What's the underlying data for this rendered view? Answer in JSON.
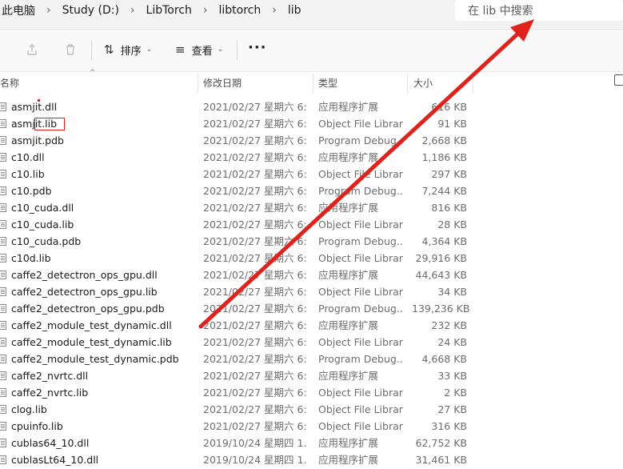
{
  "breadcrumb": [
    "此电脑",
    "Study (D:)",
    "LibTorch",
    "libtorch",
    "lib"
  ],
  "search": {
    "placeholder": "在 lib 中搜索"
  },
  "toolbar": {
    "sort_label": "排序",
    "view_label": "查看",
    "more_label": "···"
  },
  "columns": {
    "name": "名称",
    "date": "修改日期",
    "type": "类型",
    "size": "大小"
  },
  "files": [
    {
      "name": "asmjit.dll",
      "date": "2021/02/27 星期六 6:...",
      "type": "应用程序扩展",
      "size": "616 KB"
    },
    {
      "name": "asmjit.lib",
      "date": "2021/02/27 星期六 6:...",
      "type": "Object File Library",
      "size": "91 KB"
    },
    {
      "name": "asmjit.pdb",
      "date": "2021/02/27 星期六 6:...",
      "type": "Program Debug...",
      "size": "2,668 KB"
    },
    {
      "name": "c10.dll",
      "date": "2021/02/27 星期六 6:...",
      "type": "应用程序扩展",
      "size": "1,186 KB"
    },
    {
      "name": "c10.lib",
      "date": "2021/02/27 星期六 6:...",
      "type": "Object File Library",
      "size": "297 KB"
    },
    {
      "name": "c10.pdb",
      "date": "2021/02/27 星期六 6:...",
      "type": "Program Debug...",
      "size": "7,244 KB"
    },
    {
      "name": "c10_cuda.dll",
      "date": "2021/02/27 星期六 6:...",
      "type": "应用程序扩展",
      "size": "816 KB"
    },
    {
      "name": "c10_cuda.lib",
      "date": "2021/02/27 星期六 6:...",
      "type": "Object File Library",
      "size": "28 KB"
    },
    {
      "name": "c10_cuda.pdb",
      "date": "2021/02/27 星期六 6:...",
      "type": "Program Debug...",
      "size": "4,364 KB"
    },
    {
      "name": "c10d.lib",
      "date": "2021/02/27 星期六 6:...",
      "type": "Object File Library",
      "size": "29,916 KB"
    },
    {
      "name": "caffe2_detectron_ops_gpu.dll",
      "date": "2021/02/27 星期六 6:...",
      "type": "应用程序扩展",
      "size": "44,643 KB"
    },
    {
      "name": "caffe2_detectron_ops_gpu.lib",
      "date": "2021/02/27 星期六 6:...",
      "type": "Object File Library",
      "size": "34 KB"
    },
    {
      "name": "caffe2_detectron_ops_gpu.pdb",
      "date": "2021/02/27 星期六 6:...",
      "type": "Program Debug...",
      "size": "139,236 KB"
    },
    {
      "name": "caffe2_module_test_dynamic.dll",
      "date": "2021/02/27 星期六 6:...",
      "type": "应用程序扩展",
      "size": "232 KB"
    },
    {
      "name": "caffe2_module_test_dynamic.lib",
      "date": "2021/02/27 星期六 6:...",
      "type": "Object File Library",
      "size": "24 KB"
    },
    {
      "name": "caffe2_module_test_dynamic.pdb",
      "date": "2021/02/27 星期六 6:...",
      "type": "Program Debug...",
      "size": "4,668 KB"
    },
    {
      "name": "caffe2_nvrtc.dll",
      "date": "2021/02/27 星期六 6:...",
      "type": "应用程序扩展",
      "size": "33 KB"
    },
    {
      "name": "caffe2_nvrtc.lib",
      "date": "2021/02/27 星期六 6:...",
      "type": "Object File Library",
      "size": "2 KB"
    },
    {
      "name": "clog.lib",
      "date": "2021/02/27 星期六 6:...",
      "type": "Object File Library",
      "size": "27 KB"
    },
    {
      "name": "cpuinfo.lib",
      "date": "2021/02/27 星期六 6:...",
      "type": "Object File Library",
      "size": "316 KB"
    },
    {
      "name": "cublas64_10.dll",
      "date": "2019/10/24 星期四 1...",
      "type": "应用程序扩展",
      "size": "62,752 KB"
    },
    {
      "name": "cublasLt64_10.dll",
      "date": "2019/10/24 星期四 1...",
      "type": "应用程序扩展",
      "size": "31,461 KB"
    }
  ],
  "annotation_color": "#e0221c"
}
